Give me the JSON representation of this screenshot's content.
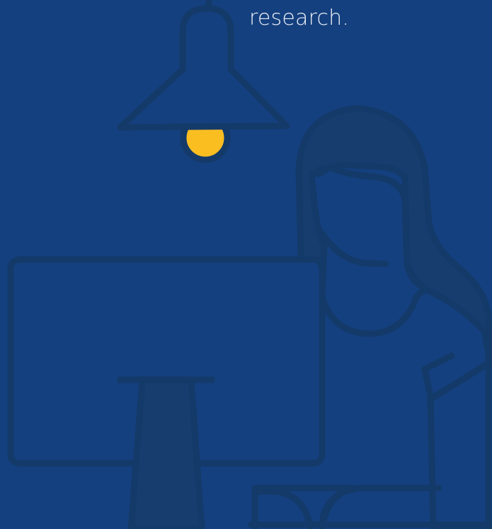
{
  "caption": {
    "text": "research."
  },
  "colors": {
    "background": "#15407f",
    "outline": "#133a69",
    "hair": "#173c6e",
    "bulb": "#fbbe21",
    "caption_text": "#e9eef7"
  },
  "icons": {
    "lamp": "pendant-lamp-icon",
    "bulb": "light-bulb-icon",
    "person": "woman-figure-icon",
    "monitor": "computer-monitor-icon"
  }
}
